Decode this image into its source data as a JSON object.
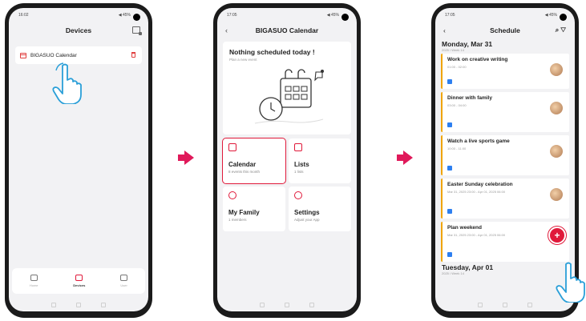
{
  "colors": {
    "accent": "#e0193a",
    "arrow": "#e0195a",
    "event_stripe": "#f0a400"
  },
  "phone1": {
    "status_time": "16:02",
    "status_right": "◀ 45%",
    "title": "Devices",
    "device_name": "BIGASUO Calendar",
    "nav": [
      {
        "label": "Home",
        "icon": "home-icon"
      },
      {
        "label": "Devices",
        "icon": "devices-icon"
      },
      {
        "label": "User",
        "icon": "user-icon"
      }
    ]
  },
  "phone2": {
    "status_time": "17:05",
    "status_right": "◀ 45%",
    "title": "BIGASUO Calendar",
    "hero_title": "Nothing scheduled today !",
    "hero_sub": "Plan a new event",
    "tiles": [
      {
        "name": "Calendar",
        "sub": "8 events this month",
        "icon": "calendar-icon"
      },
      {
        "name": "Lists",
        "sub": "1 lists",
        "icon": "list-icon"
      },
      {
        "name": "My Family",
        "sub": "1 members",
        "icon": "family-icon"
      },
      {
        "name": "Settings",
        "sub": "Adjust your App",
        "icon": "settings-icon"
      }
    ]
  },
  "phone3": {
    "status_time": "17:05",
    "status_right": "◀ 45%",
    "title": "Schedule",
    "day1": {
      "heading": "Monday, Mar 31",
      "week": "2025 / Week 14"
    },
    "events": [
      {
        "title": "Work on creative writing",
        "time": "01:00 - 02:00"
      },
      {
        "title": "Dinner with family",
        "time": "03:00 - 04:00"
      },
      {
        "title": "Watch a live sports game",
        "time": "10:00 - 11:00"
      },
      {
        "title": "Easter Sunday celebration",
        "time": "Mar 31, 2025 23:00 - Apr 01, 2025 06:00"
      },
      {
        "title": "Plan weekend",
        "time": "Mar 31, 2025 23:00 - Apr 01, 2025 06:00"
      }
    ],
    "day2": {
      "heading": "Tuesday, Apr 01",
      "week": "2025 / Week 14"
    },
    "fab_label": "+"
  }
}
